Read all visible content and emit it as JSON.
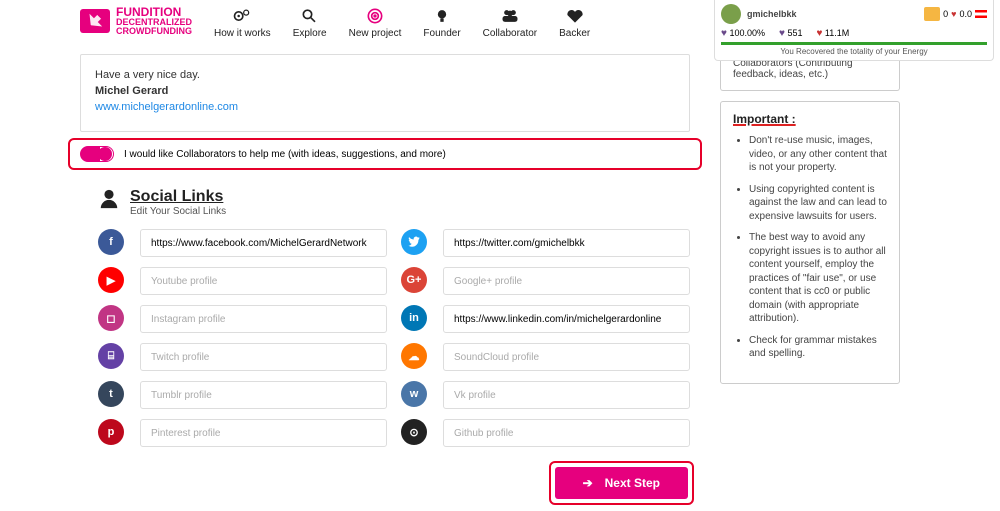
{
  "brand": {
    "line1": "FUNDITION",
    "line2": "DECENTRALIZED",
    "line3": "CROWDFUNDING"
  },
  "nav": {
    "how": "How it works",
    "explore": "Explore",
    "newproject": "New project",
    "founder": "Founder",
    "collaborator": "Collaborator",
    "backer": "Backer"
  },
  "user": {
    "name": "gmichelbkk",
    "wallet_a": "0",
    "wallet_b": "0.0",
    "stat1": "100.00%",
    "stat2": "551",
    "stat3": "11.1M",
    "energy_msg": "You Recovered the totality of your Energy"
  },
  "message": {
    "greeting": "Have a very nice day.",
    "name": "Michel Gerard",
    "url": "www.michelgerardonline.com"
  },
  "collab_toggle_label": "I would like Collaborators to help me (with ideas, suggestions, and more)",
  "social": {
    "title": "Social Links",
    "subtitle": "Edit Your Social Links",
    "facebook": {
      "value": "https://www.facebook.com/MichelGerardNetwork"
    },
    "twitter": {
      "value": "https://twitter.com/gmichelbkk"
    },
    "youtube": {
      "placeholder": "Youtube profile"
    },
    "gplus": {
      "placeholder": "Google+ profile"
    },
    "instagram": {
      "placeholder": "Instagram profile"
    },
    "linkedin": {
      "value": "https://www.linkedin.com/in/michelgerardonline"
    },
    "twitch": {
      "placeholder": "Twitch profile"
    },
    "soundcloud": {
      "placeholder": "SoundCloud profile"
    },
    "tumblr": {
      "placeholder": "Tumblr profile"
    },
    "vk": {
      "placeholder": "Vk profile"
    },
    "pinterest": {
      "placeholder": "Pinterest profile"
    },
    "github": {
      "placeholder": "Github profile"
    }
  },
  "next_label": "Next Step",
  "side_frag": "Collaborators (Contributing feedback, ideas, etc.)",
  "important": {
    "title": "Important :",
    "items": [
      "Don't re-use music, images, video, or any other content that is not your property.",
      "Using copyrighted content is against the law and can lead to expensive lawsuits for users.",
      "The best way to avoid any copyright issues is to author all content yourself, employ the practices of \"fair use\", or use content that is cc0 or public domain (with appropriate attribution).",
      "Check for grammar mistakes and spelling."
    ]
  },
  "colors": {
    "facebook": "#3b5998",
    "twitter": "#1da1f2",
    "youtube": "#ff0000",
    "gplus": "#db4437",
    "instagram": "#c13584",
    "linkedin": "#0077b5",
    "twitch": "#6441a5",
    "soundcloud": "#ff7700",
    "tumblr": "#35465c",
    "vk": "#4a76a8",
    "pinterest": "#bd081c",
    "github": "#222"
  }
}
